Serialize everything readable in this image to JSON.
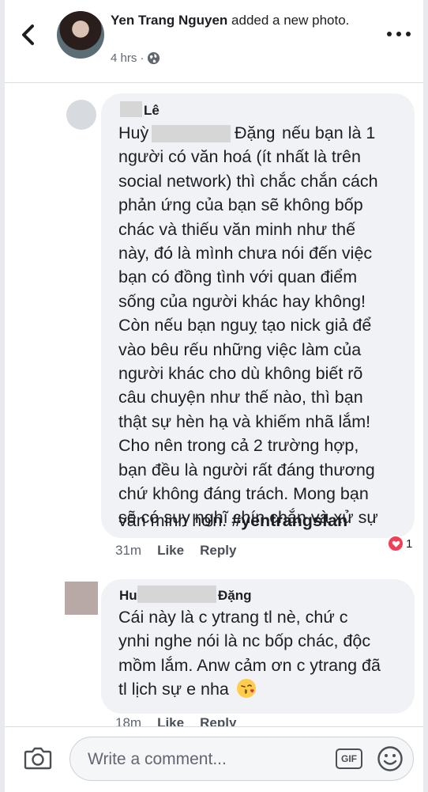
{
  "post": {
    "author": "Yen Trang Nguyen",
    "action": "added a new photo.",
    "time": "4 hrs",
    "privacy_icon": "globe-icon"
  },
  "comments": [
    {
      "name_visible": "Lê",
      "name_prefix": "Huỳ",
      "name_suffix": "Đặng",
      "lines": [
        "nếu bạn là 1",
        "người có văn hoá (ít nhất là trên",
        "social network) thì chắc chắn cách",
        "phản ứng của bạn sẽ không bốp",
        "chác và thiếu văn minh như thế",
        "này, đó là mình chưa nói đến việc",
        "bạn có đồng tình với quan điểm",
        "sống của người khác hay không!",
        "Còn nếu bạn nguỵ tạo nick giả để",
        "vào bêu rếu những việc làm của",
        "người khác cho dù không biết rõ",
        "câu chuyện như thế nào, thì bạn",
        "thật sự hèn hạ và khiếm nhã lắm!",
        "Cho nên trong cả 2 trường hợp,",
        "bạn đều là người rất đáng thương",
        "chứ không đáng trách. Mong bạn",
        "sẽ có suy nghĩ chín chắn và xử sự",
        "văn minh hơn."
      ],
      "hashtag": "#yentrangsfan",
      "time": "31m",
      "like_label": "Like",
      "reply_label": "Reply",
      "reaction_count": "1"
    },
    {
      "name_prefix": "Hu",
      "name_suffix": "Đặng",
      "lines": [
        "Cái này là c ytrang tl nè, chứ c",
        "ynhi nghe nói là nc bốp chác, độc",
        "mồm lắm. Anw cảm ơn c ytrang đã",
        "tl lịch sự e nha"
      ],
      "emoji": "kissing-face-emoji",
      "time": "18m",
      "like_label": "Like",
      "reply_label": "Reply"
    }
  ],
  "composer": {
    "placeholder": "Write a comment...",
    "gif_label": "GIF"
  },
  "colors": {
    "bubble": "#f0f2f5",
    "reaction_heart": "#f33e58",
    "meta_text": "#606770"
  }
}
